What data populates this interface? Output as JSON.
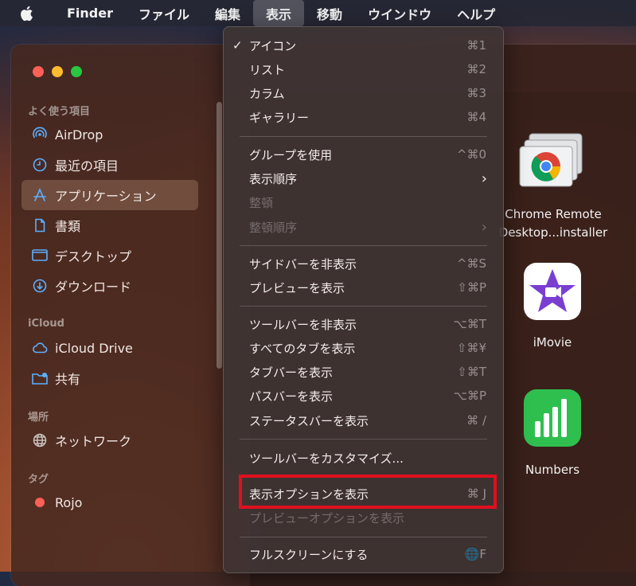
{
  "menubar": {
    "app_name": "Finder",
    "items": [
      "ファイル",
      "編集",
      "表示",
      "移動",
      "ウインドウ",
      "ヘルプ"
    ]
  },
  "sidebar": {
    "favorites_title": "よく使う項目",
    "favorites": [
      {
        "label": "AirDrop",
        "icon": "airdrop-icon"
      },
      {
        "label": "最近の項目",
        "icon": "clock-icon"
      },
      {
        "label": "アプリケーション",
        "icon": "applications-icon"
      },
      {
        "label": "書類",
        "icon": "document-icon"
      },
      {
        "label": "デスクトップ",
        "icon": "desktop-icon"
      },
      {
        "label": "ダウンロード",
        "icon": "download-icon"
      }
    ],
    "icloud_title": "iCloud",
    "icloud": [
      {
        "label": "iCloud Drive",
        "icon": "cloud-icon"
      },
      {
        "label": "共有",
        "icon": "shared-folder-icon"
      }
    ],
    "places_title": "場所",
    "places": [
      {
        "label": "ネットワーク",
        "icon": "network-icon"
      }
    ],
    "tags_title": "タグ",
    "tags": [
      {
        "label": "Rojo",
        "color": "#fe5f57"
      }
    ]
  },
  "apps": [
    {
      "label_line1": "Chrome Remote",
      "label_line2": "Desktop...installer"
    },
    {
      "label_line1": "iMovie"
    },
    {
      "label_line1": "Numbers"
    }
  ],
  "menu": {
    "items": [
      {
        "label": "アイコン",
        "shortcut": "⌘1",
        "checked": "✓"
      },
      {
        "label": "リスト",
        "shortcut": "⌘2"
      },
      {
        "label": "カラム",
        "shortcut": "⌘3"
      },
      {
        "label": "ギャラリー",
        "shortcut": "⌘4"
      },
      {
        "label": "グループを使用",
        "shortcut": "^⌘0"
      },
      {
        "label": "表示順序",
        "arrow": "›"
      },
      {
        "label": "整頓",
        "disabled": true
      },
      {
        "label": "整頓順序",
        "arrow": "›",
        "disabled": true
      },
      {
        "label": "サイドバーを非表示",
        "shortcut": "^⌘S"
      },
      {
        "label": "プレビューを表示",
        "shortcut": "⇧⌘P"
      },
      {
        "label": "ツールバーを非表示",
        "shortcut": "⌥⌘T"
      },
      {
        "label": "すべてのタブを表示",
        "shortcut": "⇧⌘¥"
      },
      {
        "label": "タブバーを表示",
        "shortcut": "⇧⌘T"
      },
      {
        "label": "パスバーを表示",
        "shortcut": "⌥⌘P"
      },
      {
        "label": "ステータスバーを表示",
        "shortcut": "⌘ /"
      },
      {
        "label": "ツールバーをカスタマイズ..."
      },
      {
        "label": "表示オプションを表示",
        "shortcut": "⌘ J",
        "highlighted": true
      },
      {
        "label": "プレビューオプションを表示",
        "disabled": true
      },
      {
        "label": "フルスクリーンにする",
        "shortcut": "🌐F"
      }
    ]
  },
  "colors": {
    "highlight_border": "#e0101e"
  }
}
